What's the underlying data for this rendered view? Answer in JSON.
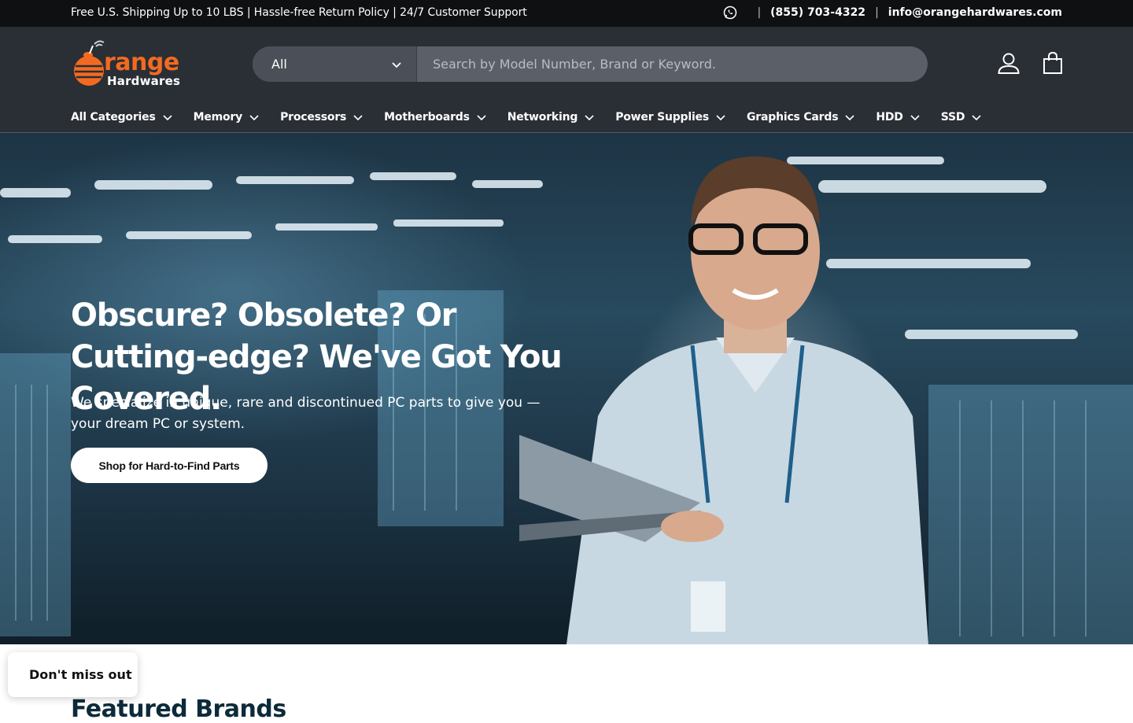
{
  "topbar": {
    "promo": "Free U.S. Shipping Up to 10 LBS | Hassle-free Return Policy | 24/7 Customer Support",
    "phone": "(855) 703-4322",
    "email": "info@orangehardwares.com",
    "separator": "|"
  },
  "logo": {
    "word1": "range",
    "word2": "Hardwares"
  },
  "search": {
    "category": "All",
    "placeholder": "Search by Model Number, Brand or Keyword."
  },
  "nav": {
    "items": [
      {
        "label": "All Categories"
      },
      {
        "label": "Memory"
      },
      {
        "label": "Processors"
      },
      {
        "label": "Motherboards"
      },
      {
        "label": "Networking"
      },
      {
        "label": "Power Supplies"
      },
      {
        "label": "Graphics Cards"
      },
      {
        "label": "HDD"
      },
      {
        "label": "SSD"
      }
    ]
  },
  "hero": {
    "title": "Obscure? Obsolete? Or Cutting-edge? We've Got You Covered.",
    "subtitle": "We specialize in unique, rare and discontinued PC parts to give you — your dream PC or system.",
    "cta": "Shop for Hard-to-Find Parts"
  },
  "popup": {
    "label": "Don't miss out"
  },
  "section": {
    "title": "Featured Brands"
  },
  "colors": {
    "brand": "#f26a21",
    "header": "#2a2e35",
    "topbar": "#0f1012"
  }
}
